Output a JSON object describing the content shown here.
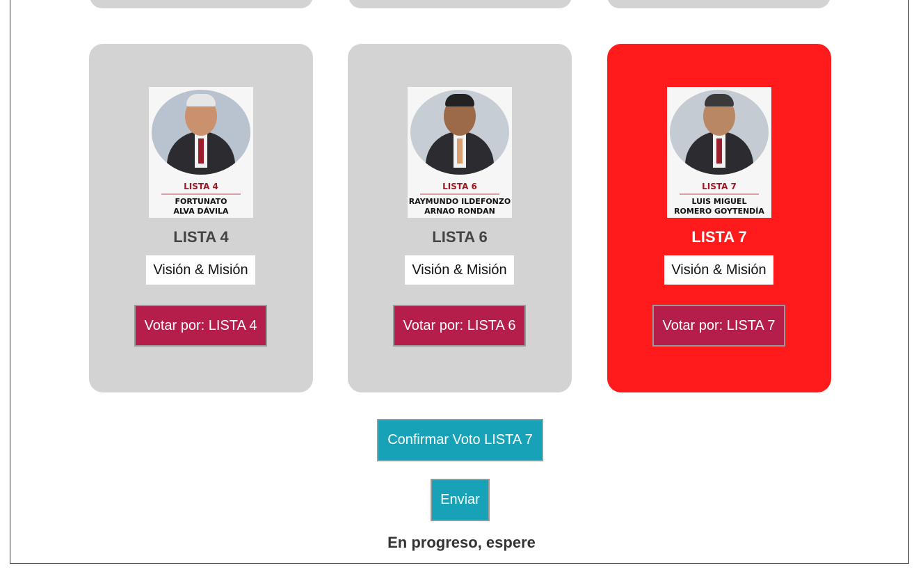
{
  "candidates": [
    {
      "title": "LISTA 4",
      "vision_label": "Visión & Misión",
      "vote_label": "Votar por: LISTA 4",
      "photo_list": "LISTA 4",
      "photo_name_line1": "FORTUNATO",
      "photo_name_line2": "ALVA DÁVILA",
      "selected": false
    },
    {
      "title": "LISTA 6",
      "vision_label": "Visión & Misión",
      "vote_label": "Votar por: LISTA 6",
      "photo_list": "LISTA 6",
      "photo_name_line1": "RAYMUNDO ILDEFONZO",
      "photo_name_line2": "ARNAO RONDAN",
      "selected": false
    },
    {
      "title": "LISTA 7",
      "vision_label": "Visión & Misión",
      "vote_label": "Votar por: LISTA 7",
      "photo_list": "LISTA 7",
      "photo_name_line1": "LUIS MIGUEL",
      "photo_name_line2": "ROMERO GOYTENDÍA",
      "selected": true
    }
  ],
  "actions": {
    "confirm_label": "Confirmar Voto LISTA 7",
    "send_label": "Enviar"
  },
  "status": "En progreso, espere",
  "colors": {
    "card_bg": "#d3d3d3",
    "card_selected_bg": "#ff1b1b",
    "vote_button_bg": "#b51d4a",
    "action_button_bg": "#17a2b8"
  }
}
